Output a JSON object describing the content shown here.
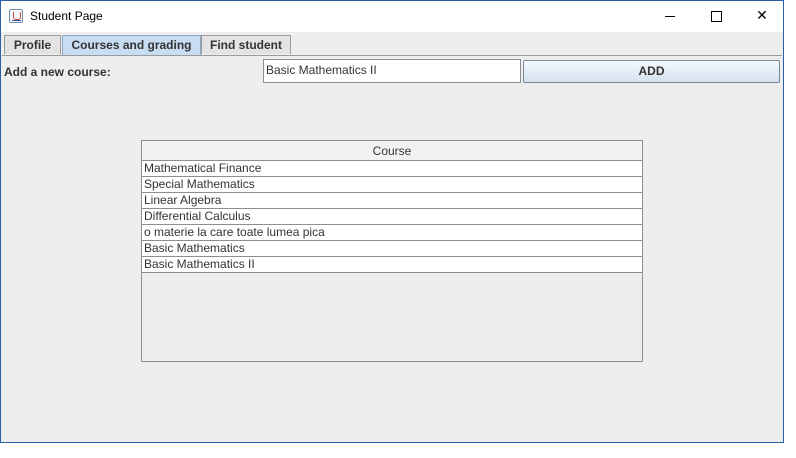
{
  "window": {
    "title": "Student Page"
  },
  "tabs": [
    {
      "label": "Profile",
      "active": false
    },
    {
      "label": "Courses and grading",
      "active": true
    },
    {
      "label": "Find student",
      "active": false
    }
  ],
  "form": {
    "add_label": "Add a new course:",
    "course_input_value": "Basic Mathematics II",
    "add_button_label": "ADD"
  },
  "table": {
    "column_header": "Course",
    "rows": [
      "Mathematical Finance",
      "Special Mathematics",
      "Linear Algebra",
      "Differential Calculus",
      "o materie la care toate lumea pica",
      "Basic Mathematics",
      "Basic Mathematics II"
    ]
  },
  "colors": {
    "active_tab": "#c8ddf2",
    "panel_background": "#eeeeee",
    "window_border": "#2b5fa8"
  },
  "icons": {
    "app": "java-cup-icon",
    "minimize": "minimize-icon",
    "maximize": "maximize-icon",
    "close": "close-icon"
  }
}
